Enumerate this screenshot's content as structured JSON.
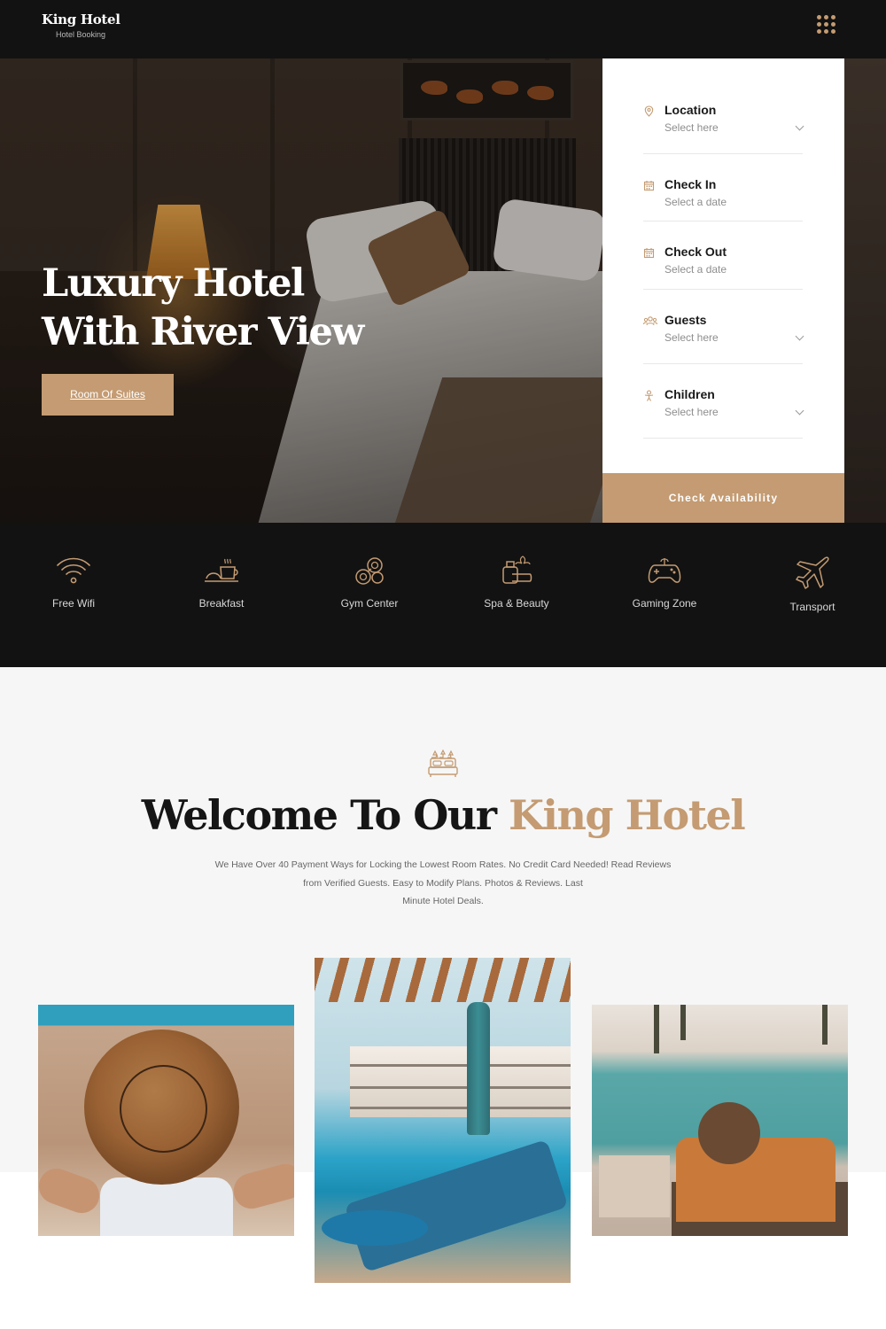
{
  "colors": {
    "accent": "#c49b72",
    "dark": "#121212",
    "light_bg": "#f6f6f6"
  },
  "header": {
    "brand_name": "King Hotel",
    "brand_sub": "Hotel Booking",
    "menu_icon": "grid-menu-icon"
  },
  "hero": {
    "title_line1": "Luxury Hotel",
    "title_line2": "With River View",
    "button_label": "Room Of Suites"
  },
  "booking": {
    "fields": [
      {
        "label": "Location",
        "value": "Select here",
        "icon": "map-pin-icon",
        "dropdown": true
      },
      {
        "label": "Check In",
        "value": "Select a date",
        "icon": "calendar-icon",
        "dropdown": false
      },
      {
        "label": "Check Out",
        "value": "Select a date",
        "icon": "calendar-icon",
        "dropdown": false
      },
      {
        "label": "Guests",
        "value": "Select here",
        "icon": "users-icon",
        "dropdown": true
      },
      {
        "label": "Children",
        "value": "Select here",
        "icon": "child-icon",
        "dropdown": true
      }
    ],
    "submit_label": "Check Availability"
  },
  "amenities": [
    {
      "label": "Free Wifi",
      "icon": "wifi-icon"
    },
    {
      "label": "Breakfast",
      "icon": "breakfast-icon"
    },
    {
      "label": "Gym Center",
      "icon": "dumbbell-icon"
    },
    {
      "label": "Spa & Beauty",
      "icon": "spa-icon"
    },
    {
      "label": "Gaming Zone",
      "icon": "gamepad-icon"
    },
    {
      "label": "Transport",
      "icon": "airplane-icon"
    }
  ],
  "welcome": {
    "icon": "hotel-bed-icon",
    "title_main": "Welcome To Our",
    "title_accent": "King Hotel",
    "text_line1": "We Have Over 40 Payment Ways for Locking the Lowest Room Rates. No Credit Card Needed! Read Reviews",
    "text_line2": "from Verified Guests. Easy to Modify Plans. Photos & Reviews. Last",
    "text_line3": "Minute Hotel Deals."
  }
}
